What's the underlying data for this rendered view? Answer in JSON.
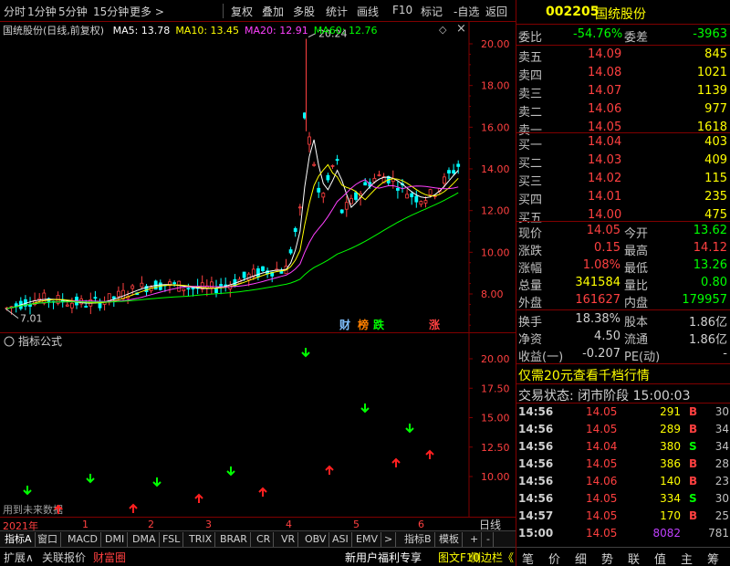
{
  "toolbar": {
    "items": [
      "分时",
      "1分钟",
      "5分钟",
      "15分钟",
      "更多 >",
      "复权",
      "叠加",
      "多股",
      "统计",
      "画线",
      "F10",
      "标记",
      "-自选",
      "返回"
    ],
    "close": "×"
  },
  "chart": {
    "title": "国统股份(日线,前复权)",
    "ma": [
      {
        "label": "MA5: 13.78",
        "color": "#ffffff"
      },
      {
        "label": "MA10: 13.45",
        "color": "#ffff00"
      },
      {
        "label": "MA20: 12.91",
        "color": "#ff40ff"
      },
      {
        "label": "MA60: 12.76",
        "color": "#00ff00"
      }
    ],
    "y_ticks": [
      "20.00",
      "18.00",
      "16.00",
      "14.00",
      "12.00",
      "10.00",
      "8.00"
    ],
    "high_label": "20.24",
    "low_label": "7.01",
    "markers": [
      {
        "text": "财",
        "color": "#80c0ff"
      },
      {
        "text": "榜",
        "color": "#ff8000"
      },
      {
        "text": "跌",
        "color": "#00ff00"
      },
      {
        "text": "涨",
        "color": "#ff4040"
      }
    ]
  },
  "indicator": {
    "title": "指标公式",
    "y_ticks": [
      "20.00",
      "17.50",
      "15.00",
      "12.50",
      "10.00"
    ],
    "future_note": "用到未来数据"
  },
  "date_row": {
    "year": "2021年",
    "months": [
      "1",
      "2",
      "3",
      "4",
      "5",
      "6"
    ]
  },
  "tabs": {
    "items": [
      "指标A",
      "窗口",
      "MACD",
      "DMI",
      "DMA",
      "FSL",
      "TRIX",
      "BRAR",
      "CR",
      "VR",
      "OBV",
      "ASI",
      "EMV",
      ">",
      "指标B",
      "模板",
      "+",
      "-",
      "日线"
    ]
  },
  "statusbar": {
    "items": [
      "扩展∧",
      "关联报价",
      "财富圈"
    ],
    "right": [
      "新用户福利专享",
      "图文F10",
      "侧边栏《"
    ]
  },
  "quote": {
    "code": "002205",
    "name": "国统股份",
    "webi_label": "委比",
    "webi": "-54.76%",
    "weicha_label": "委差",
    "weicha": "-3963",
    "asks": [
      {
        "label": "卖五",
        "price": "14.09",
        "vol": "845"
      },
      {
        "label": "卖四",
        "price": "14.08",
        "vol": "1021"
      },
      {
        "label": "卖三",
        "price": "14.07",
        "vol": "1139"
      },
      {
        "label": "卖二",
        "price": "14.06",
        "vol": "977"
      },
      {
        "label": "卖一",
        "price": "14.05",
        "vol": "1618"
      }
    ],
    "bids": [
      {
        "label": "买一",
        "price": "14.04",
        "vol": "403"
      },
      {
        "label": "买二",
        "price": "14.03",
        "vol": "409"
      },
      {
        "label": "买三",
        "price": "14.02",
        "vol": "115"
      },
      {
        "label": "买四",
        "price": "14.01",
        "vol": "235"
      },
      {
        "label": "买五",
        "price": "14.00",
        "vol": "475"
      }
    ],
    "stats": [
      {
        "l1": "现价",
        "v1": "14.05",
        "c1": "#ff4040",
        "l2": "今开",
        "v2": "13.62",
        "c2": "#00ff00"
      },
      {
        "l1": "涨跌",
        "v1": "0.15",
        "c1": "#ff4040",
        "l2": "最高",
        "v2": "14.12",
        "c2": "#ff4040"
      },
      {
        "l1": "涨幅",
        "v1": "1.08%",
        "c1": "#ff4040",
        "l2": "最低",
        "v2": "13.26",
        "c2": "#00ff00"
      },
      {
        "l1": "总量",
        "v1": "341584",
        "c1": "#ffff00",
        "l2": "量比",
        "v2": "0.80",
        "c2": "#00ff00"
      },
      {
        "l1": "外盘",
        "v1": "161627",
        "c1": "#ff4040",
        "l2": "内盘",
        "v2": "179957",
        "c2": "#00ff00"
      }
    ],
    "stats2": [
      {
        "l1": "换手",
        "v1": "18.38%",
        "l2": "股本",
        "v2": "1.86亿"
      },
      {
        "l1": "净资",
        "v1": "4.50",
        "l2": "流通",
        "v2": "1.86亿"
      },
      {
        "l1": "收益(一)",
        "v1": "-0.207",
        "l2": "PE(动)",
        "v2": "-"
      }
    ],
    "promo": "仅需20元查看千档行情",
    "status": "交易状态: 闭市阶段 15:00:03",
    "ticks": [
      {
        "time": "14:56",
        "price": "14.05",
        "vol": "291",
        "side": "B",
        "n": "30"
      },
      {
        "time": "14:56",
        "price": "14.05",
        "vol": "289",
        "side": "B",
        "n": "34"
      },
      {
        "time": "14:56",
        "price": "14.04",
        "vol": "380",
        "side": "S",
        "n": "34"
      },
      {
        "time": "14:56",
        "price": "14.05",
        "vol": "386",
        "side": "B",
        "n": "28"
      },
      {
        "time": "14:56",
        "price": "14.06",
        "vol": "140",
        "side": "B",
        "n": "23"
      },
      {
        "time": "14:56",
        "price": "14.05",
        "vol": "334",
        "side": "S",
        "n": "30"
      },
      {
        "time": "14:57",
        "price": "14.05",
        "vol": "170",
        "side": "B",
        "n": "25"
      },
      {
        "time": "15:00",
        "price": "14.05",
        "vol": "8082",
        "side": "",
        "n": "781"
      }
    ],
    "bottom_tabs": [
      "笔",
      "价",
      "细",
      "势",
      "联",
      "值",
      "主",
      "筹"
    ]
  },
  "colors": {
    "up": "#ff4040",
    "down": "#00ff00",
    "grid": "#800000",
    "label": "#c0c0c0"
  }
}
